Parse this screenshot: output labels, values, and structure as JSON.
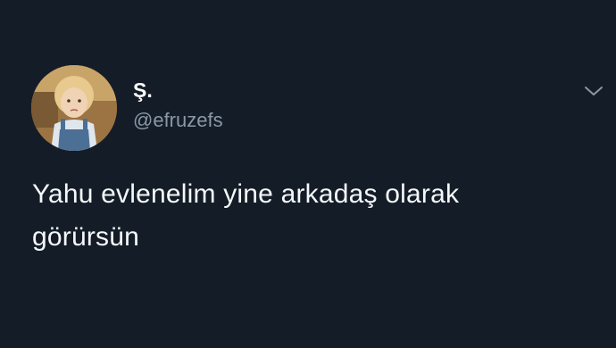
{
  "tweet": {
    "author": {
      "display_name": "Ş.",
      "handle": "@efruzefs",
      "avatar_icon": "profile-photo-avatar"
    },
    "menu_icon": "chevron-down-icon",
    "text_lines": [
      "Yahu evlenelim yine arkadaş olarak",
      "görürsün"
    ]
  },
  "colors": {
    "background": "#141d27",
    "name": "#ffffff",
    "handle": "#8a98a5",
    "text": "#f5f8fa",
    "chevron": "#8a98a5"
  }
}
